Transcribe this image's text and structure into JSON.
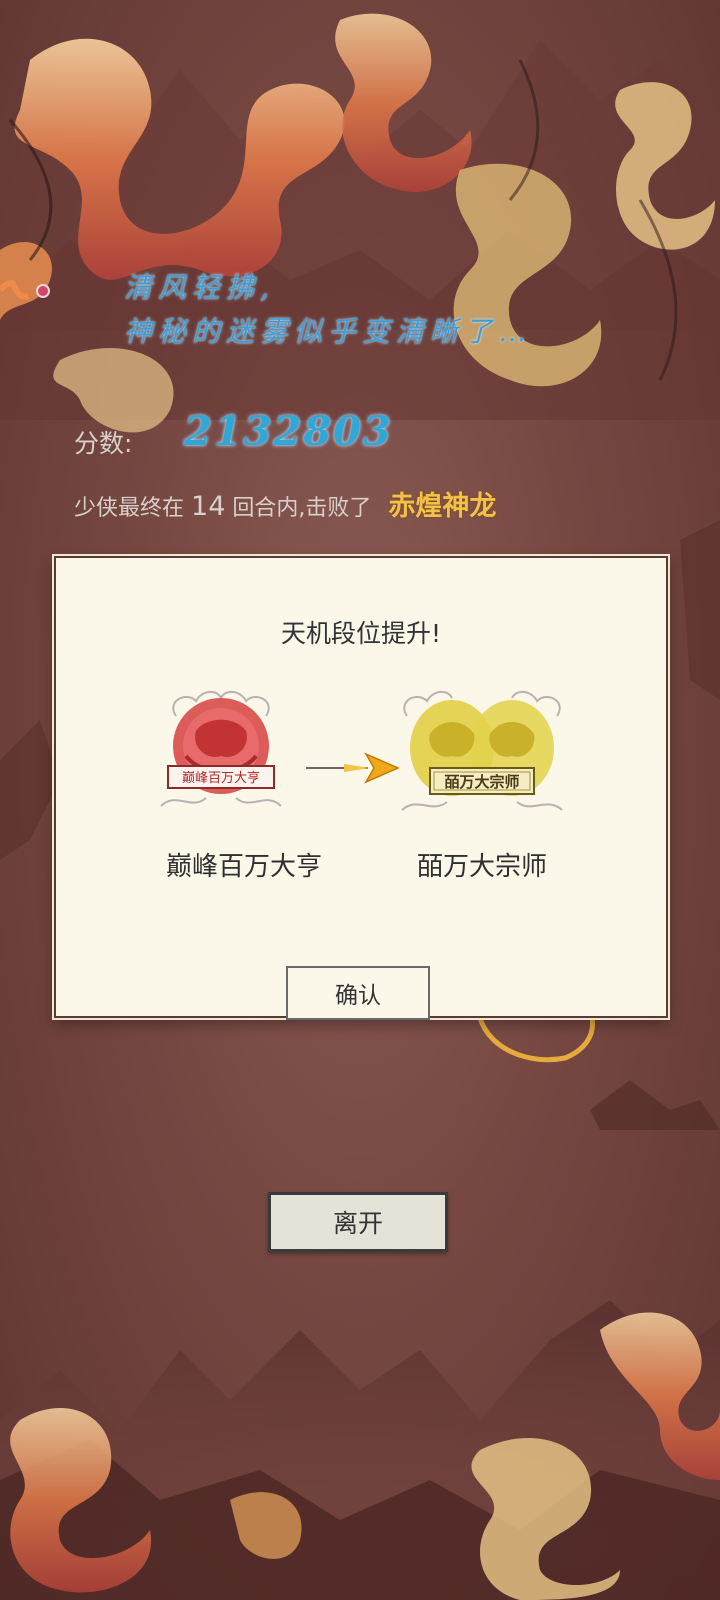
{
  "hint": {
    "line1": "清风轻拂,",
    "line2": "神秘的迷雾似乎变清晰了…"
  },
  "score": {
    "label": "分数:",
    "value": "2132803"
  },
  "result": {
    "prefix": "少侠最终在",
    "rounds": "14",
    "suffix": "回合内,击败了",
    "boss": "赤煌神龙"
  },
  "dialog": {
    "title": "天机段位提升!",
    "from_rank": "巅峰百万大亨",
    "from_plaque": "巅峰百万大亨",
    "to_rank": "皕万大宗师",
    "to_plaque": "皕万大宗师",
    "confirm_label": "确认"
  },
  "leave_label": "离开",
  "colors": {
    "background": "#7a4a44",
    "hint_text": "#3d9ed6",
    "boss_text": "#f2c14b",
    "dialog_bg": "#fbf8ea",
    "from_badge": "#d84a4a",
    "to_badge": "#e0cd3c",
    "arrow": "#f0a818"
  }
}
